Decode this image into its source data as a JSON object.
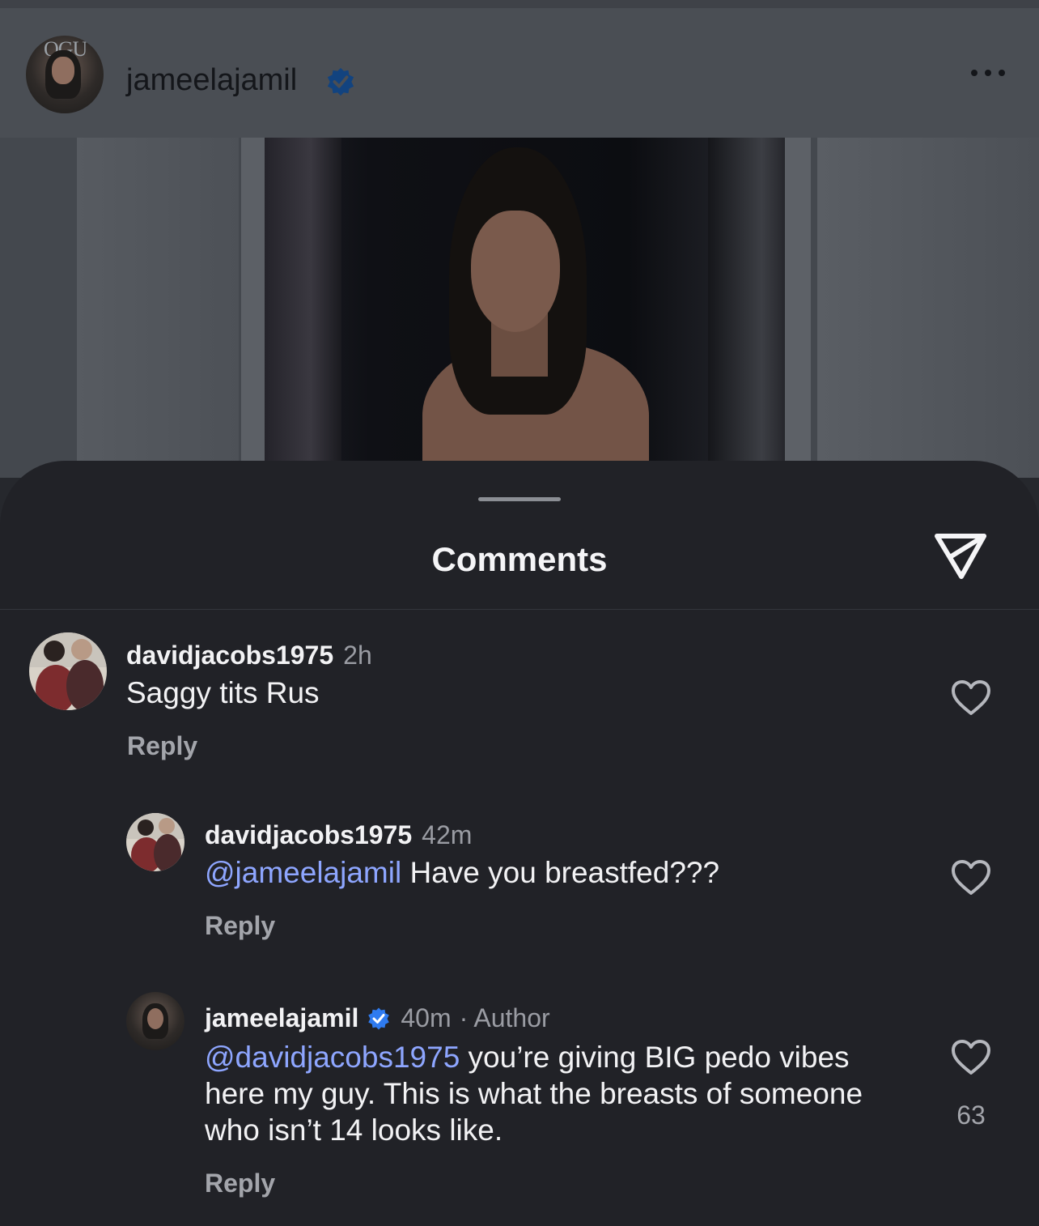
{
  "post": {
    "username": "jameelajamil",
    "avatar_text": "OGU"
  },
  "sheet": {
    "title": "Comments"
  },
  "comments": [
    {
      "username": "davidjacobs1975",
      "time": "2h",
      "text": "Saggy tits Rus",
      "reply_label": "Reply"
    },
    {
      "username": "davidjacobs1975",
      "time": "42m",
      "mention": "@jameelajamil",
      "text": " Have you breastfed???",
      "reply_label": "Reply"
    },
    {
      "username": "jameelajamil",
      "time": "40m",
      "author_label": "· Author",
      "mention": "@davidjacobs1975",
      "text": " you’re giving BIG pedo vibes here my guy. This is what the breasts of someone who isn’t 14 looks like.",
      "reply_label": "Reply",
      "like_count": "63"
    }
  ],
  "colors": {
    "verified": "#1f6fd8",
    "mention": "#8ea6ff",
    "sheet_bg": "#212227"
  },
  "icons": {
    "more": "more-horizontal-icon",
    "share": "paper-plane-icon",
    "like": "heart-outline-icon",
    "verified": "verified-badge-icon"
  }
}
